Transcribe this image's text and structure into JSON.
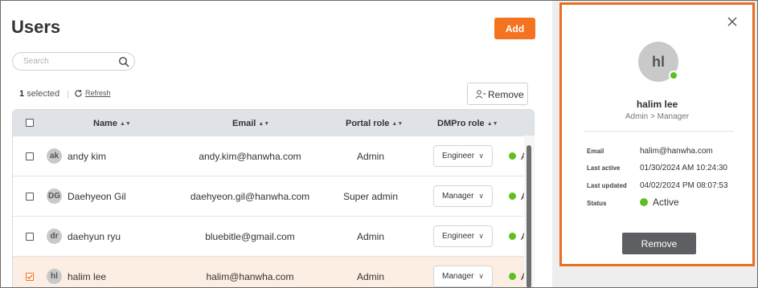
{
  "page": {
    "title": "Users"
  },
  "toolbar": {
    "add_label": "Add",
    "remove_label": "Remove"
  },
  "search": {
    "placeholder": "Search"
  },
  "selection": {
    "count": "1",
    "label": "selected",
    "refresh_label": "Refresh"
  },
  "table": {
    "headers": {
      "name": "Name",
      "email": "Email",
      "portal_role": "Portal role",
      "dmpro_role": "DMPro role"
    },
    "rows": [
      {
        "initials": "ak",
        "name": "andy kim",
        "email": "andy.kim@hanwha.com",
        "portal_role": "Admin",
        "dmpro_role": "Engineer",
        "status": "A",
        "selected": false
      },
      {
        "initials": "DG",
        "name": "Daehyeon Gil",
        "email": "daehyeon.gil@hanwha.com",
        "portal_role": "Super admin",
        "dmpro_role": "Manager",
        "status": "A",
        "selected": false
      },
      {
        "initials": "dr",
        "name": "daehyun ryu",
        "email": "bluebitle@gmail.com",
        "portal_role": "Admin",
        "dmpro_role": "Engineer",
        "status": "A",
        "selected": false
      },
      {
        "initials": "hl",
        "name": "halim lee",
        "email": "halim@hanwha.com",
        "portal_role": "Admin",
        "dmpro_role": "Manager",
        "status": "A",
        "selected": true
      }
    ]
  },
  "panel": {
    "initials": "hl",
    "name": "halim lee",
    "role_path": "Admin > Manager",
    "fields": {
      "email_label": "Email",
      "email_value": "halim@hanwha.com",
      "last_active_label": "Last active",
      "last_active_value": "01/30/2024 AM 10:24:30",
      "last_updated_label": "Last updated",
      "last_updated_value": "04/02/2024 PM 08:07:53",
      "status_label": "Status",
      "status_value": "Active"
    },
    "remove_label": "Remove"
  },
  "colors": {
    "accent": "#f37321",
    "status_active": "#5fbf22",
    "panel_border": "#ea6e1f"
  },
  "icons": [
    "search-icon",
    "refresh-icon",
    "remove-user-icon",
    "sort-icon",
    "chevron-down-icon",
    "close-icon"
  ]
}
